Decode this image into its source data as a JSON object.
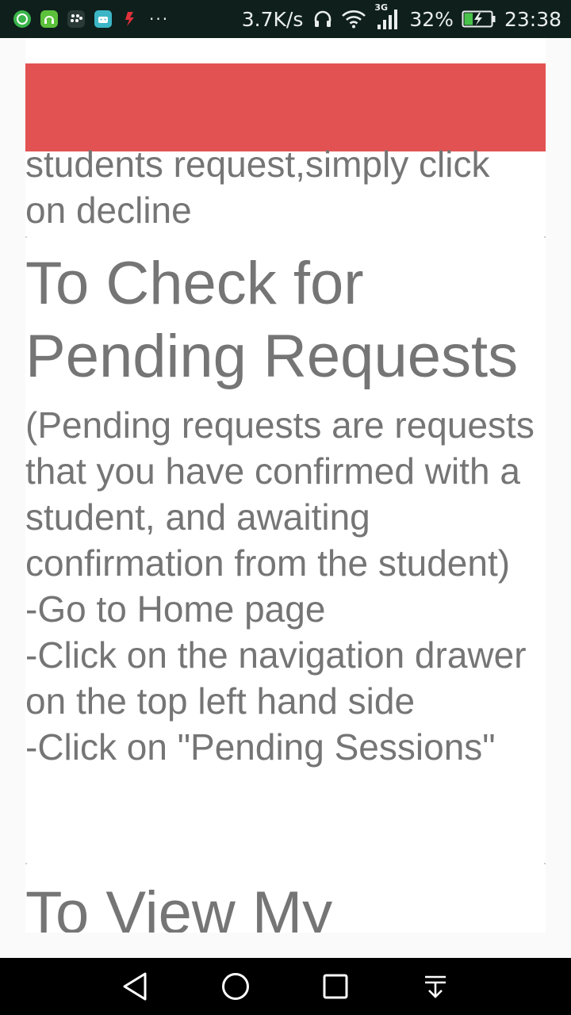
{
  "status_bar": {
    "net_speed": "3.7K/s",
    "network_type": "3G",
    "battery_percent": "32%",
    "time": "23:38",
    "notification_icons": [
      "whatsapp-icon",
      "green-app-icon",
      "blackberry-icon",
      "android-app-icon",
      "red-app-icon"
    ],
    "more": "···",
    "battery_level": 0.32
  },
  "content": {
    "previous_section_tail": "students request,simply click\non decline",
    "sections": [
      {
        "heading": "To Check for Pending Requests",
        "body": "(Pending requests are requests that you have confirmed with a student, and awaiting confirmation from the student)\n-Go to Home page\n-Click on the navigation drawer on the top left hand side\n-Click on \"Pending Sessions\""
      },
      {
        "heading": "To View My"
      }
    ]
  },
  "nav_bar": {
    "icons": [
      "back-icon",
      "home-icon",
      "recents-icon",
      "notification-pull-icon"
    ]
  },
  "colors": {
    "status_bar_bg": "#0f1f1c",
    "banner": "#e35252",
    "text": "#757575",
    "nav_bar_bg": "#000000"
  }
}
